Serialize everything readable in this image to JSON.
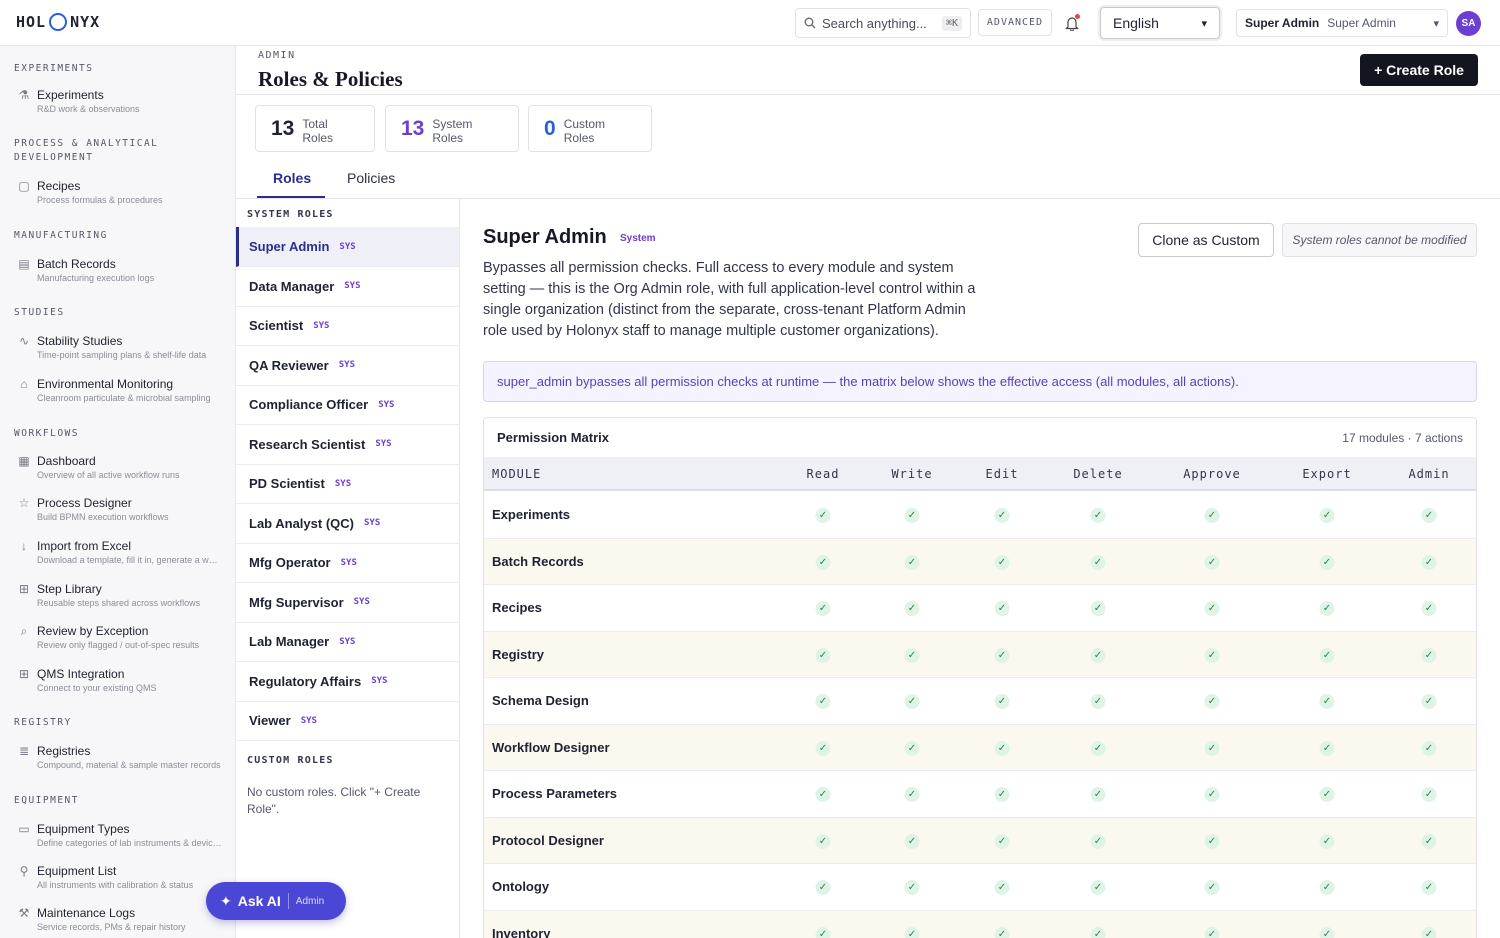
{
  "brand": {
    "left": "HOL",
    "right": "NYX"
  },
  "topbar": {
    "search_placeholder": "Search anything...",
    "search_shortcut": "⌘K",
    "advanced_label": "ADVANCED",
    "language": "English",
    "user_name": "Super Admin",
    "user_role": "Super Admin",
    "avatar_initials": "SA"
  },
  "sidebar": {
    "sections": [
      {
        "title": "EXPERIMENTS",
        "items": [
          {
            "label": "Experiments",
            "sub": "R&D work & observations",
            "icon": "flask-icon"
          }
        ]
      },
      {
        "title": "PROCESS & ANALYTICAL DEVELOPMENT",
        "items": [
          {
            "label": "Recipes",
            "sub": "Process formulas & procedures",
            "icon": "document-icon"
          }
        ]
      },
      {
        "title": "MANUFACTURING",
        "items": [
          {
            "label": "Batch Records",
            "sub": "Manufacturing execution logs",
            "icon": "clipboard-icon"
          }
        ]
      },
      {
        "title": "STUDIES",
        "items": [
          {
            "label": "Stability Studies",
            "sub": "Time-point sampling plans & shelf-life data",
            "icon": "pulse-icon"
          },
          {
            "label": "Environmental Monitoring",
            "sub": "Cleanroom particulate & microbial sampling",
            "icon": "building-icon"
          }
        ]
      },
      {
        "title": "WORKFLOWS",
        "items": [
          {
            "label": "Dashboard",
            "sub": "Overview of all active workflow runs",
            "icon": "grid-icon"
          },
          {
            "label": "Process Designer",
            "sub": "Build BPMN execution workflows",
            "icon": "star-icon"
          },
          {
            "label": "Import from Excel",
            "sub": "Download a template, fill it in, generate a workflow",
            "icon": "download-icon"
          },
          {
            "label": "Step Library",
            "sub": "Reusable steps shared across workflows",
            "icon": "blocks-icon"
          },
          {
            "label": "Review by Exception",
            "sub": "Review only flagged / out-of-spec results",
            "icon": "search-icon"
          },
          {
            "label": "QMS Integration",
            "sub": "Connect to your existing QMS",
            "icon": "blocks-icon"
          }
        ]
      },
      {
        "title": "REGISTRY",
        "items": [
          {
            "label": "Registries",
            "sub": "Compound, material & sample master records",
            "icon": "database-icon"
          }
        ]
      },
      {
        "title": "EQUIPMENT",
        "items": [
          {
            "label": "Equipment Types",
            "sub": "Define categories of lab instruments & devices",
            "icon": "toolbox-icon"
          },
          {
            "label": "Equipment List",
            "sub": "All instruments with calibration & status",
            "icon": "person-icon"
          },
          {
            "label": "Maintenance Logs",
            "sub": "Service records, PMs & repair history",
            "icon": "wrench-icon"
          }
        ]
      }
    ]
  },
  "page": {
    "breadcrumb": "ADMIN",
    "title": "Roles & Policies",
    "create_button": "+ Create Role"
  },
  "stats": [
    {
      "value": "13",
      "label": "Total Roles",
      "color": "#1f2230"
    },
    {
      "value": "13",
      "label": "System Roles",
      "color": "#6b3fd1"
    },
    {
      "value": "0",
      "label": "Custom Roles",
      "color": "#2b5fd9"
    }
  ],
  "tabs": [
    {
      "label": "Roles",
      "active": true
    },
    {
      "label": "Policies",
      "active": false
    }
  ],
  "rolelist": {
    "system_heading": "SYSTEM ROLES",
    "sys_badge": "SYS",
    "system_roles": [
      "Super Admin",
      "Data Manager",
      "Scientist",
      "QA Reviewer",
      "Compliance Officer",
      "Research Scientist",
      "PD Scientist",
      "Lab Analyst (QC)",
      "Mfg Operator",
      "Mfg Supervisor",
      "Lab Manager",
      "Regulatory Affairs",
      "Viewer"
    ],
    "active_index": 0,
    "custom_heading": "CUSTOM ROLES",
    "no_custom_text": "No custom roles. Click \"+ Create Role\"."
  },
  "detail": {
    "title": "Super Admin",
    "badge": "System",
    "clone_button": "Clone as Custom",
    "locked_note": "System roles cannot be modified",
    "description": "Bypasses all permission checks. Full access to every module and system setting — this is the Org Admin role, with full application-level control within a single organization (distinct from the separate, cross-tenant Platform Admin role used by Holonyx staff to manage multiple customer organizations).",
    "notice": "super_admin bypasses all permission checks at runtime — the matrix below shows the effective access (all modules, all actions)."
  },
  "matrix": {
    "title": "Permission Matrix",
    "count": "17 modules · 7 actions",
    "module_header": "MODULE",
    "actions": [
      "Read",
      "Write",
      "Edit",
      "Delete",
      "Approve",
      "Export",
      "Admin"
    ],
    "modules": [
      "Experiments",
      "Batch Records",
      "Recipes",
      "Registry",
      "Schema Design",
      "Workflow Designer",
      "Process Parameters",
      "Protocol Designer",
      "Ontology",
      "Inventory"
    ],
    "granted": true
  },
  "askai": {
    "label": "Ask AI",
    "context": "Admin"
  }
}
